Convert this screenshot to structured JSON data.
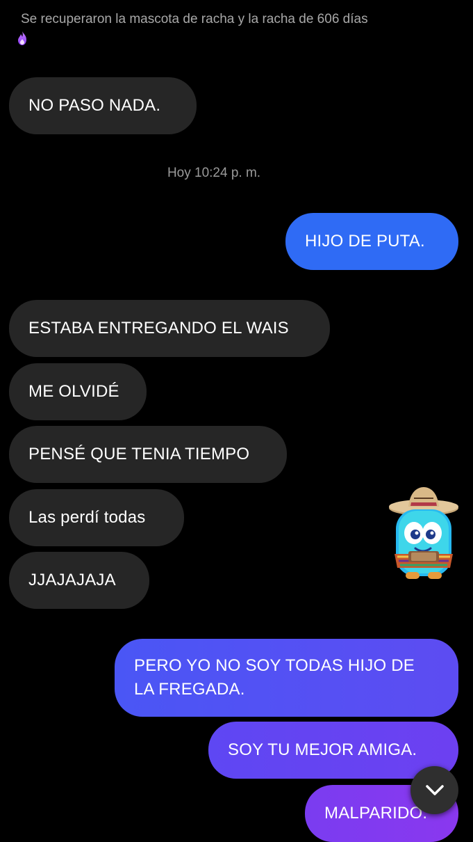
{
  "system_notice": {
    "text": "Se recuperaron la mascota de racha y la racha de 606 días",
    "icon": "flame-icon"
  },
  "messages_top": {
    "m1": "NO PASO NADA."
  },
  "timestamp": "Hoy 10:24 p. m.",
  "messages": {
    "out1": "HIJO DE PUTA.",
    "in1": "ESTABA ENTREGANDO EL WAIS",
    "in2": "ME OLVIDÉ",
    "in3": "PENSÉ QUE TENIA TIEMPO",
    "in4": "Las perdí todas",
    "in5": "JJAJAJAJA",
    "out2": "PERO YO NO SOY TODAS HIJO DE LA FREGADA.",
    "out3": "SOY TU MEJOR AMIGA.",
    "out4": "MALPARIDO."
  },
  "sticker": {
    "icon": "streak-mascot-sombrero-sticker"
  },
  "scroll_button": {
    "icon": "chevron-down-icon"
  },
  "colors": {
    "background": "#000000",
    "incoming_bubble": "#262626",
    "outgoing_blue": "#3b6cf6",
    "outgoing_violet": "#7a3cf0",
    "timestamp_text": "#9a9a9a"
  }
}
